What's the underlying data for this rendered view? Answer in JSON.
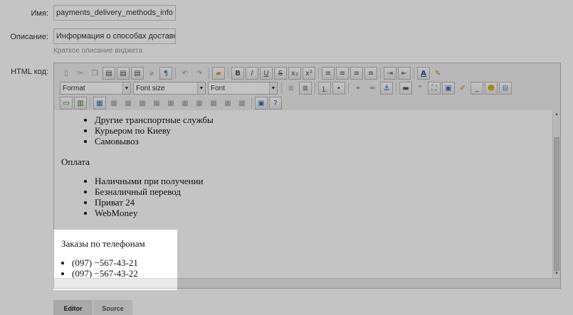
{
  "form": {
    "name_label": "Имя:",
    "name_value": "payments_delivery_methods_info",
    "description_label": "Описание:",
    "description_value": "Информация о способах доставк",
    "description_hint": "Краткое описание виджета",
    "html_label": "HTML код:"
  },
  "toolbar": {
    "format_combo": "Format",
    "fontsize_combo": "Font size",
    "font_combo": "Font"
  },
  "content": {
    "list1": [
      "Другие транспортные службы",
      "Курьером по Киеву",
      "Самовывоз"
    ],
    "payment_heading": "Оплата",
    "list2": [
      "Наличными при получении",
      "Безналичный перевод",
      "Приват 24",
      "WebMoney"
    ],
    "phones_heading": "Заказы по телефонам",
    "phones": [
      "(097) −567-43-21",
      "(097) −567-43-22"
    ]
  },
  "tabs": {
    "editor": "Editor",
    "source": "Source"
  }
}
